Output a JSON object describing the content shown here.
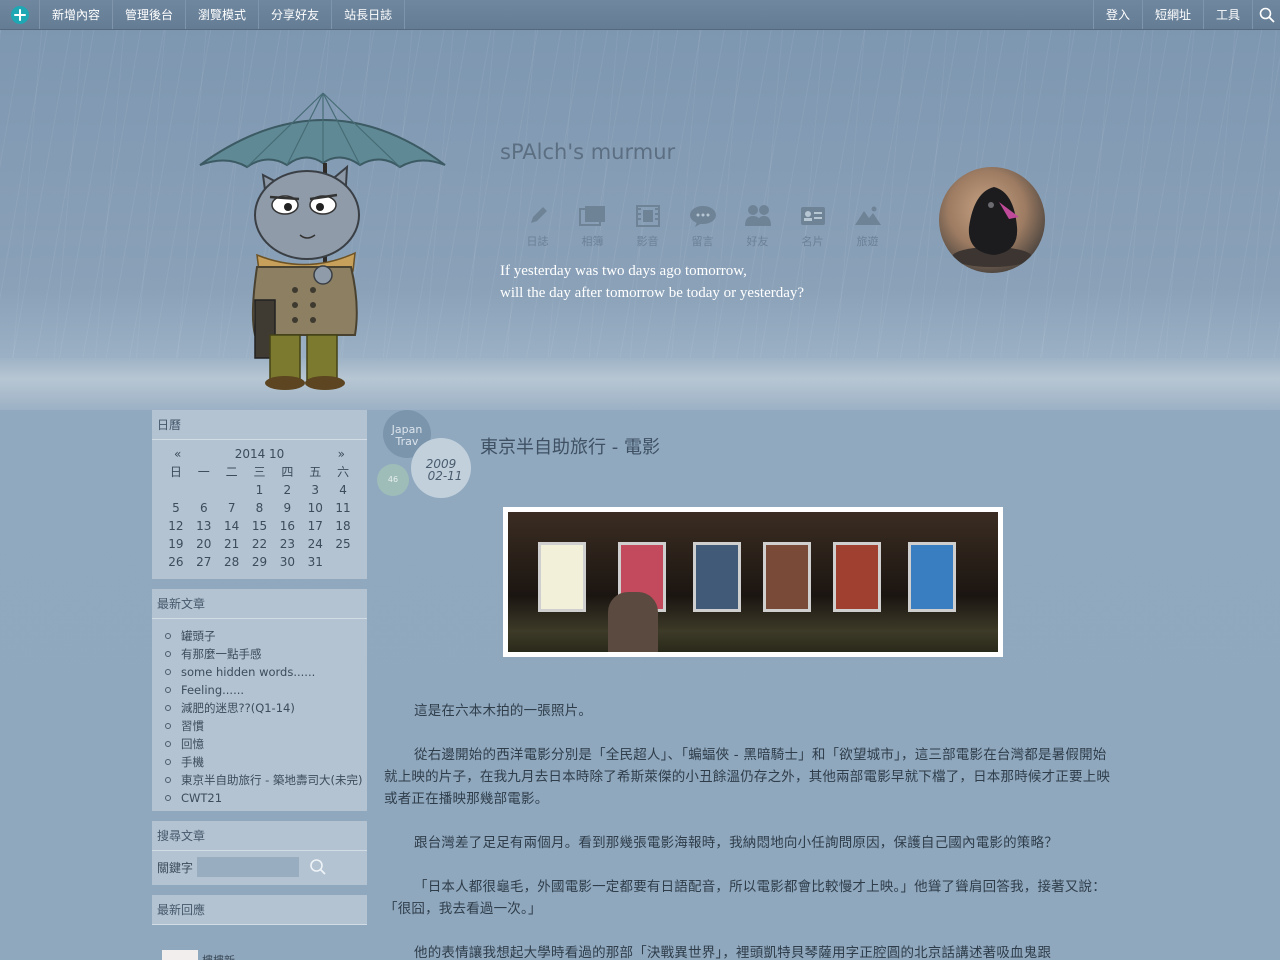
{
  "topbar": {
    "left_items": [
      "新增內容",
      "管理後台",
      "瀏覽模式",
      "分享好友",
      "站長日誌"
    ],
    "right_items": [
      "登入",
      "短網址",
      "工具"
    ]
  },
  "header": {
    "title": "sPAlch's murmur",
    "nav": [
      {
        "label": "日誌",
        "icon": "pencil-icon"
      },
      {
        "label": "相簿",
        "icon": "photos-icon"
      },
      {
        "label": "影音",
        "icon": "film-icon"
      },
      {
        "label": "留言",
        "icon": "chat-icon"
      },
      {
        "label": "好友",
        "icon": "friends-icon"
      },
      {
        "label": "名片",
        "icon": "card-icon"
      },
      {
        "label": "旅遊",
        "icon": "mountain-icon"
      }
    ],
    "tagline_line1": "If yesterday was two days ago tomorrow,",
    "tagline_line2": "will the day after tomorrow be today or yesterday?"
  },
  "calendar": {
    "title": "日曆",
    "prev": "«",
    "month": "2014 10",
    "next": "»",
    "weekdays": [
      "日",
      "一",
      "二",
      "三",
      "四",
      "五",
      "六"
    ],
    "days": [
      "",
      "",
      "",
      "1",
      "2",
      "3",
      "4",
      "5",
      "6",
      "7",
      "8",
      "9",
      "10",
      "11",
      "12",
      "13",
      "14",
      "15",
      "16",
      "17",
      "18",
      "19",
      "20",
      "21",
      "22",
      "23",
      "24",
      "25",
      "26",
      "27",
      "28",
      "29",
      "30",
      "31",
      ""
    ]
  },
  "recent_posts": {
    "title": "最新文章",
    "items": [
      "罐頭子",
      "有那麼一點手感",
      "some hidden words......",
      "Feeling......",
      "減肥的迷思??(Q1-14)",
      "習慣",
      "回憶",
      "手機",
      "東京半自助旅行 - 築地壽司大(未完)",
      "CWT21"
    ]
  },
  "search": {
    "title": "搜尋文章",
    "label": "關鍵字",
    "placeholder": ""
  },
  "recent_comments": {
    "title": "最新回應",
    "first_author": "樓樓新"
  },
  "post": {
    "category": "Japan Trav",
    "date_year": "2009",
    "date_md": "02-11",
    "comments": "46",
    "title": "東京半自助旅行 - 電影",
    "paragraphs": [
      "這是在六本木拍的一張照片。",
      "從右邊開始的西洋電影分別是「全民超人」、「蝙蝠俠 - 黑暗騎士」和「欲望城市」，這三部電影在台灣都是暑假開始就上映的片子，在我九月去日本時除了希斯萊傑的小丑餘溫仍存之外，其他兩部電影早就下檔了，日本那時候才正要上映或者正在播映那幾部電影。",
      "跟台灣差了足足有兩個月。看到那幾張電影海報時，我納悶地向小任詢問原因，保護自己國內電影的策略？",
      "「日本人都很龜毛，外國電影一定都要有日語配音，所以電影都會比較慢才上映。」他聳了聳肩回答我，接著又說：「很囧，我去看過一次。」",
      "他的表情讓我想起大學時看過的那部「決戰異世界」，裡頭凱特貝琴薩用字正腔圓的北京話講述著吸血鬼跟"
    ]
  },
  "colors": {
    "topbar": "#6f879f",
    "sidebar_widget": "#b3c3d2",
    "accent_teal": "#1fa7b4"
  }
}
